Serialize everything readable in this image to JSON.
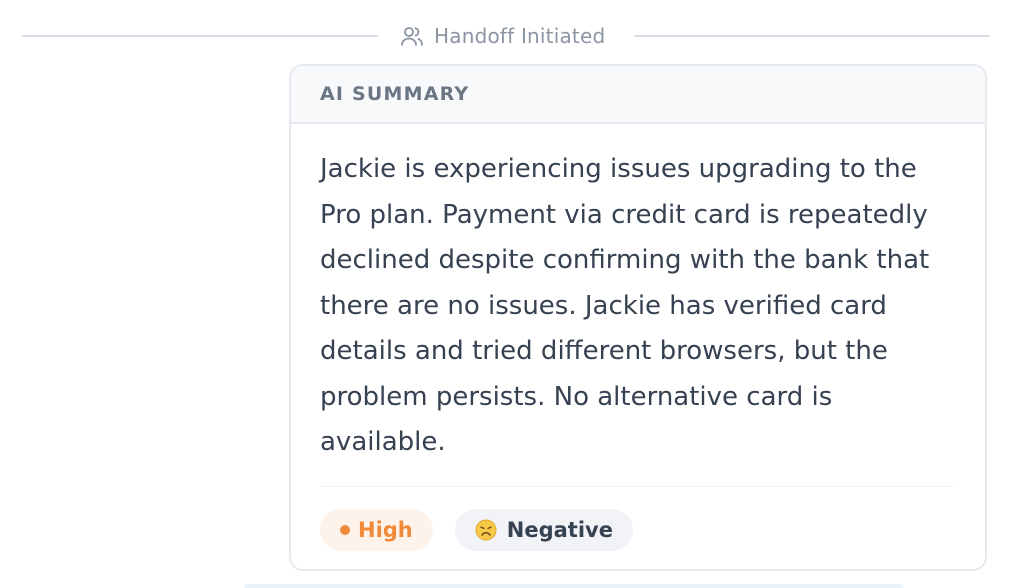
{
  "handoff": {
    "label": "Handoff Initiated",
    "icon": "users-icon",
    "color": "#8a94a3"
  },
  "summary_card": {
    "header": "AI SUMMARY",
    "text": "Jackie is experiencing issues upgrading to the Pro plan. Payment via credit card is repeatedly declined despite confirming with the bank that there are no issues. Jackie has verified card details and tried different browsers, but the problem persists. No alternative card is available.",
    "badges": {
      "priority": {
        "label": "High",
        "color": "#f08a3b",
        "background": "#fdf3ea",
        "icon": "dot-icon"
      },
      "sentiment": {
        "label": "Negative",
        "color": "#364152",
        "background": "#f1f3f6",
        "icon": "disappointed-face-icon"
      }
    }
  }
}
